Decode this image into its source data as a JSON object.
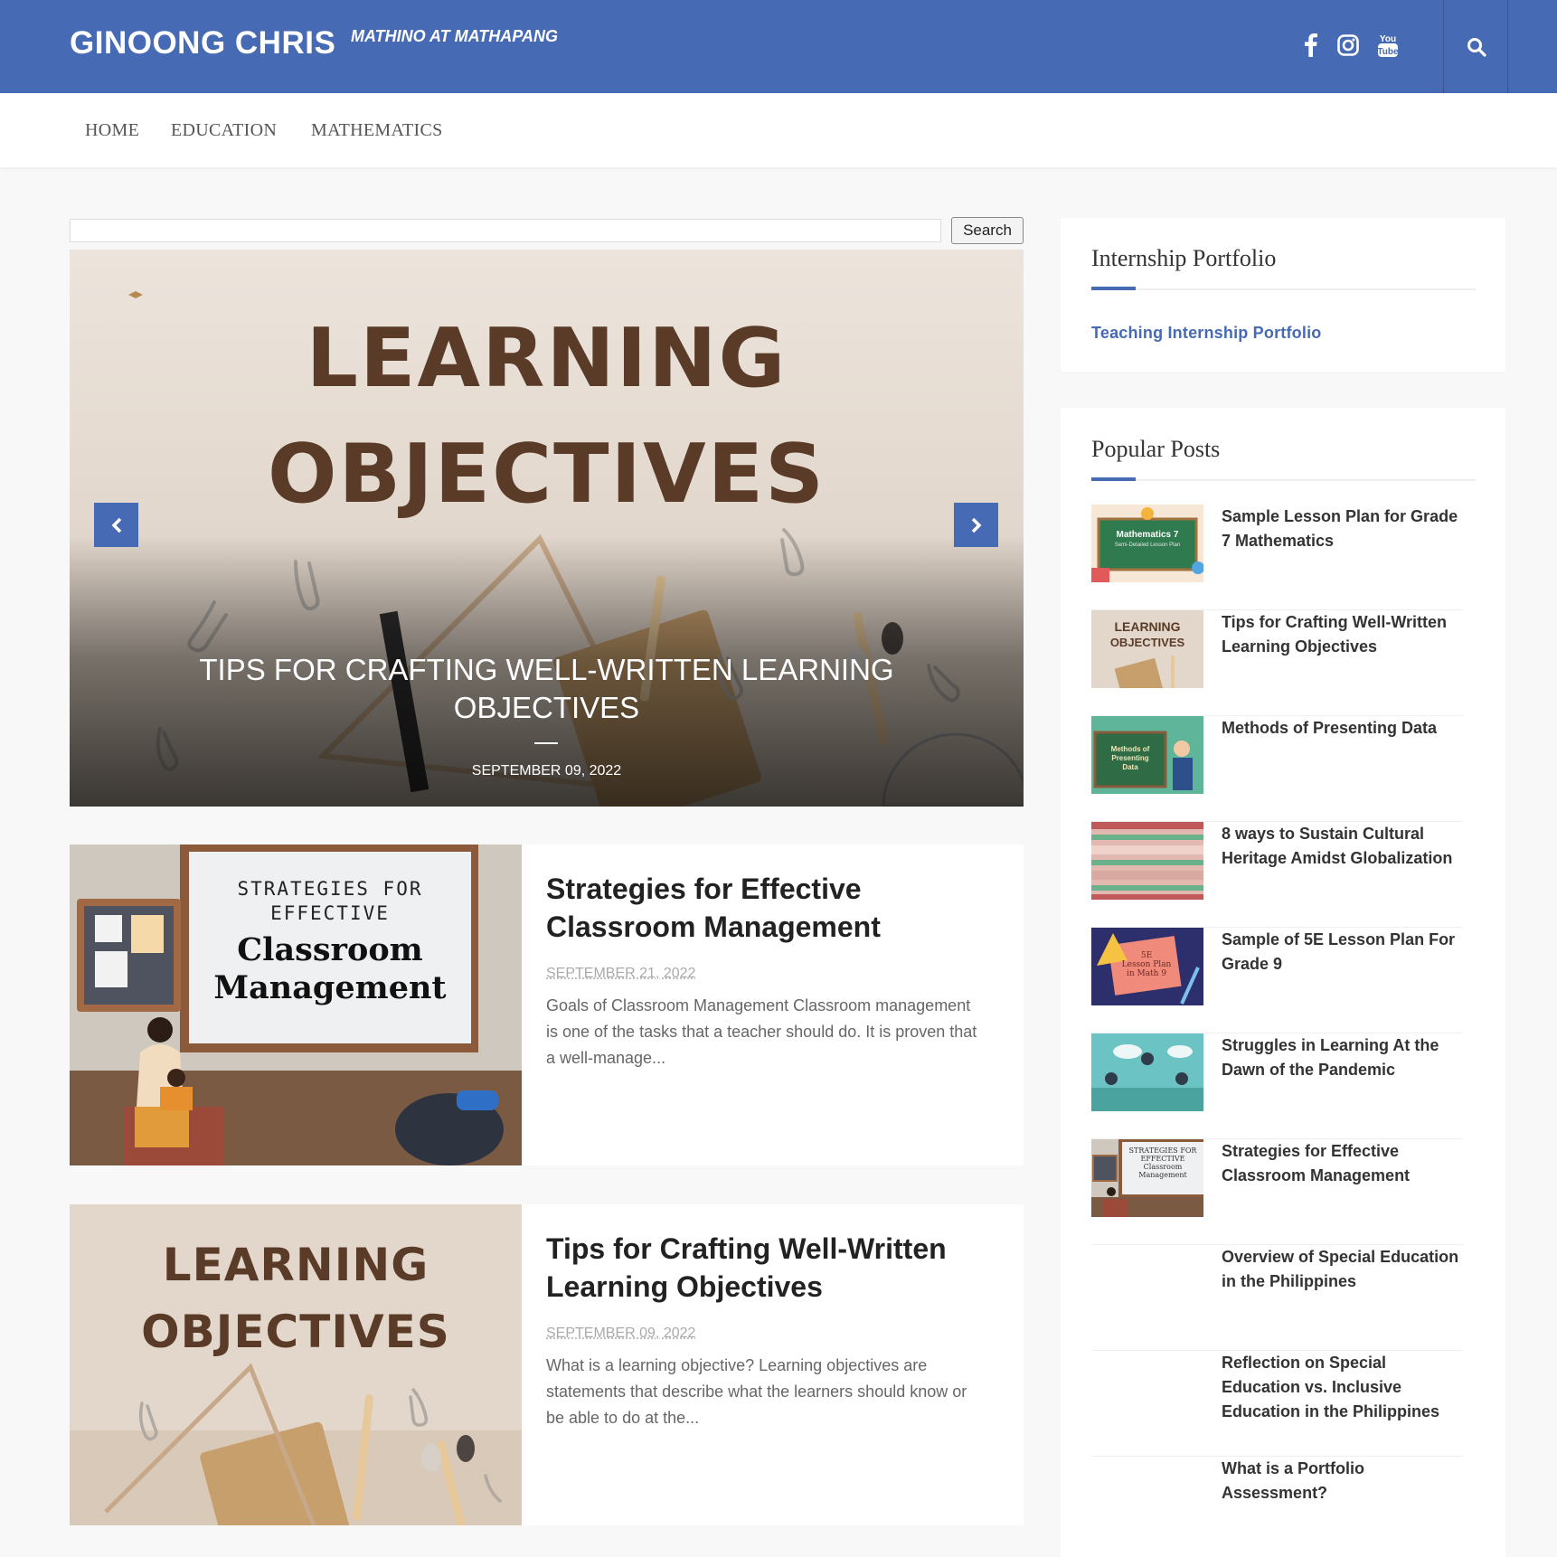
{
  "header": {
    "brand": "GINOONG CHRIS",
    "tagline": "MATHINO AT MATHAPANG",
    "social": [
      "facebook-icon",
      "instagram-icon",
      "youtube-icon"
    ],
    "accent_color": "#466ab3"
  },
  "nav": {
    "items": [
      "HOME",
      "EDUCATION",
      "MATHEMATICS"
    ]
  },
  "search": {
    "placeholder": "",
    "button_label": "Search"
  },
  "slider": {
    "image_text": [
      "LEARNING",
      "OBJECTIVES"
    ],
    "caption": "TIPS FOR CRAFTING WELL-WRITTEN LEARNING OBJECTIVES",
    "date": "SEPTEMBER 09, 2022"
  },
  "posts": [
    {
      "image_text": [
        "STRATEGIES FOR",
        "EFFECTIVE",
        "Classroom",
        "Management"
      ],
      "title": "Strategies for Effective Classroom Management",
      "date": "SEPTEMBER 21, 2022",
      "excerpt": "Goals of Classroom Management Classroom management is one of the tasks that a teacher should do. It is proven that a well-manage..."
    },
    {
      "image_text": [
        "LEARNING",
        "OBJECTIVES"
      ],
      "title": "Tips for Crafting Well-Written Learning Objectives",
      "date": "SEPTEMBER 09, 2022",
      "excerpt": "What is a learning objective? Learning objectives are statements that describe what the learners should know or be able to do at the..."
    }
  ],
  "sidebar": {
    "internship": {
      "title": "Internship Portfolio",
      "link": "Teaching Internship Portfolio"
    },
    "popular": {
      "title": "Popular Posts",
      "items": [
        {
          "title": "Sample Lesson Plan for Grade 7 Mathematics",
          "thumb_text": [
            "Mathematics 7",
            "Semi-Detailed Lesson Plan"
          ]
        },
        {
          "title": "Tips for Crafting Well-Written Learning Objectives",
          "thumb_text": [
            "LEARNING",
            "OBJECTIVES"
          ]
        },
        {
          "title": "Methods of Presenting Data",
          "thumb_text": [
            "Methods of",
            "Presenting",
            "Data"
          ]
        },
        {
          "title": "8 ways to Sustain Cultural Heritage Amidst Globalization",
          "thumb_text": []
        },
        {
          "title": "Sample of 5E Lesson Plan For Grade 9",
          "thumb_text": [
            "5E",
            "Lesson Plan",
            "in Math 9"
          ]
        },
        {
          "title": "Struggles in Learning At the Dawn of the Pandemic",
          "thumb_text": []
        },
        {
          "title": "Strategies for Effective Classroom Management",
          "thumb_text": [
            "STRATEGIES FOR",
            "EFFECTIVE",
            "Classroom",
            "Management"
          ]
        },
        {
          "title": "Overview of Special Education in the Philippines",
          "thumb_text": []
        },
        {
          "title": "Reflection on Special Education vs. Inclusive Education in the Philippines",
          "thumb_text": []
        },
        {
          "title": "What is a Portfolio Assessment?",
          "thumb_text": []
        }
      ]
    }
  }
}
